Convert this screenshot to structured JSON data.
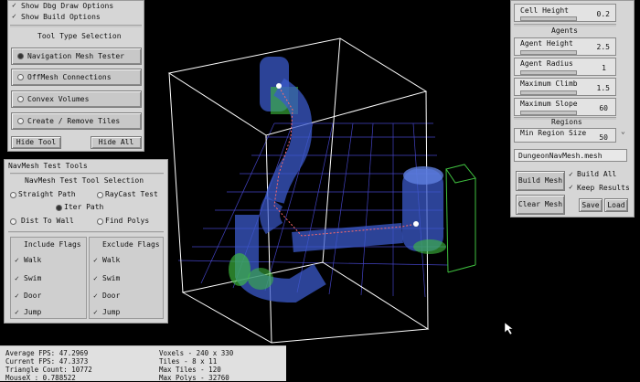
{
  "left_panel": {
    "debug_options": [
      {
        "label": "Show Dbg Draw Options",
        "checked": true
      },
      {
        "label": "Show Build Options",
        "checked": true
      }
    ],
    "tool_type_title": "Tool Type Selection",
    "tools": [
      {
        "label": "Navigation Mesh Tester",
        "selected": true
      },
      {
        "label": "OffMesh Connections",
        "selected": false
      },
      {
        "label": "Convex Volumes",
        "selected": false
      },
      {
        "label": "Create / Remove Tiles",
        "selected": false
      }
    ],
    "hide_tool": "Hide Tool",
    "hide_all": "Hide All"
  },
  "navmesh_tools": {
    "title": "NavMesh Test Tools",
    "subtitle": "NavMesh Test Tool Selection",
    "modes": [
      {
        "label": "Straight Path",
        "selected": false
      },
      {
        "label": "RayCast Test",
        "selected": false
      },
      {
        "label": "Iter Path",
        "selected": true
      },
      {
        "label": "Dist To Wall",
        "selected": false
      },
      {
        "label": "Find Polys",
        "selected": false
      }
    ],
    "include_flags_title": "Include Flags",
    "exclude_flags_title": "Exclude Flags",
    "include_flags": [
      {
        "label": "Walk",
        "checked": true
      },
      {
        "label": "Swim",
        "checked": true
      },
      {
        "label": "Door",
        "checked": true
      },
      {
        "label": "Jump",
        "checked": true
      }
    ],
    "exclude_flags": [
      {
        "label": "Walk",
        "checked": true
      },
      {
        "label": "Swim",
        "checked": true
      },
      {
        "label": "Door",
        "checked": true
      },
      {
        "label": "Jump",
        "checked": true
      }
    ]
  },
  "right_panel": {
    "cell_height_label": "Cell Height",
    "cell_height_value": "0.2",
    "agents_title": "Agents",
    "agent_settings": [
      {
        "label": "Agent Height",
        "value": "2.5"
      },
      {
        "label": "Agent Radius",
        "value": "1"
      },
      {
        "label": "Maximum Climb",
        "value": "1.5"
      },
      {
        "label": "Maximum Slope",
        "value": "60"
      }
    ],
    "regions_title": "Regions",
    "min_region_label": "Min Region Size",
    "min_region_value": "50",
    "mesh_file": "DungeonNavMesh.mesh",
    "build_mesh": "Build Mesh",
    "clear_mesh": "Clear Mesh",
    "build_all": "Build All",
    "keep_results": "Keep Results",
    "save": "Save",
    "load": "Load"
  },
  "stats": {
    "avg_fps": "Average FPS: 47.2969",
    "cur_fps": "Current FPS: 47.3373",
    "tri_count": "Triangle Count: 10772",
    "mouse_x": "MouseX : 0.788522",
    "voxels": "Voxels - 240  x  330",
    "tiles": "Tiles - 8  x  11",
    "max_tiles": "Max Tiles - 120",
    "max_polys": "Max Polys - 32760"
  },
  "colors": {
    "mesh": "#3b59c9",
    "green": "#3fbf3f",
    "box": "#ffffff",
    "grid": "#4b4bd8",
    "path": "#ff6b6b",
    "panel_bg": "#d6d6d6"
  }
}
